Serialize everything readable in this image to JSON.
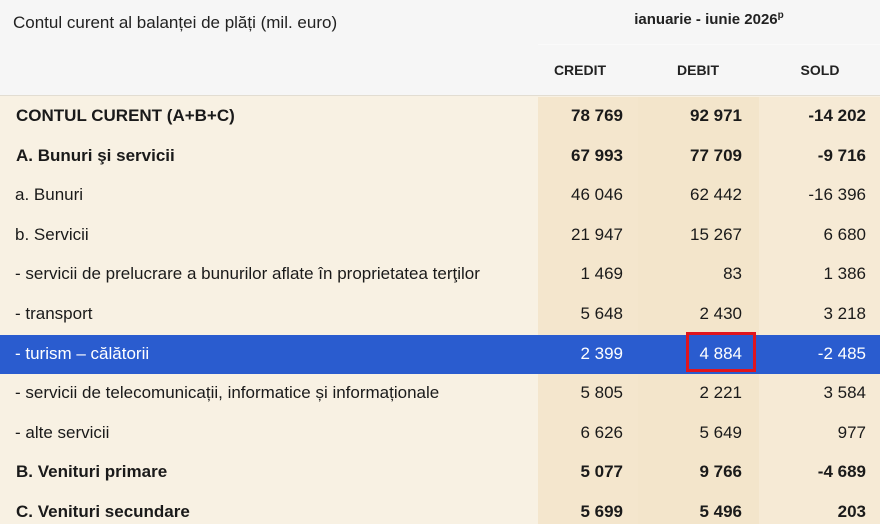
{
  "header": {
    "title": "Contul curent al balanței de plăți (mil. euro)",
    "period": "ianuarie - iunie 2026",
    "period_note": "p",
    "columns": [
      "CREDIT",
      "DEBIT",
      "SOLD"
    ]
  },
  "rows": [
    {
      "label": "CONTUL CURENT (A+B+C)",
      "credit": "78 769",
      "debit": "92 971",
      "sold": "-14 202",
      "bold": true
    },
    {
      "label": "A. Bunuri şi servicii",
      "credit": "67 993",
      "debit": "77 709",
      "sold": "-9 716",
      "bold": true
    },
    {
      "label": "a. Bunuri",
      "credit": "46 046",
      "debit": "62 442",
      "sold": "-16 396",
      "bold": false
    },
    {
      "label": "b. Servicii",
      "credit": "21 947",
      "debit": "15 267",
      "sold": "6 680",
      "bold": false
    },
    {
      "label": "-  servicii de prelucrare a bunurilor aflate în proprietatea terţilor",
      "credit": "1 469",
      "debit": "83",
      "sold": "1 386",
      "bold": false
    },
    {
      "label": "- transport",
      "credit": "5 648",
      "debit": "2 430",
      "sold": "3 218",
      "bold": false
    },
    {
      "label": "- turism – călătorii",
      "credit": "2 399",
      "debit": "4 884",
      "sold": "-2 485",
      "bold": false,
      "highlighted": true
    },
    {
      "label": "-  servicii de telecomunicații, informatice și informaționale",
      "credit": "5 805",
      "debit": "2 221",
      "sold": "3 584",
      "bold": false
    },
    {
      "label": "- alte servicii",
      "credit": "6 626",
      "debit": "5 649",
      "sold": "977",
      "bold": false
    },
    {
      "label": "B. Venituri primare",
      "credit": "5 077",
      "debit": "9 766",
      "sold": "-4 689",
      "bold": true
    },
    {
      "label": "C. Venituri secundare",
      "credit": "5 699",
      "debit": "5 496",
      "sold": "203",
      "bold": true
    }
  ],
  "colors": {
    "highlight_row": "#2a5ccf",
    "focus_border": "#e0151d"
  }
}
